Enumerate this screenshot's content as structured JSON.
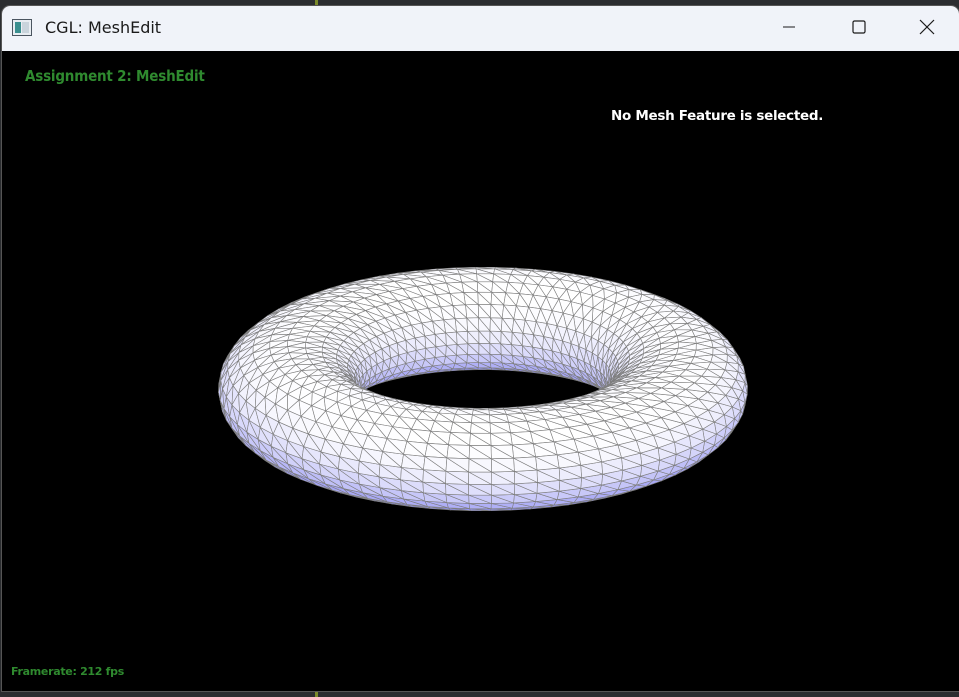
{
  "window": {
    "title": "CGL: MeshEdit",
    "app_icon": "app-window-icon"
  },
  "controls": {
    "minimize_icon": "minimize-icon",
    "maximize_icon": "maximize-icon",
    "close_icon": "close-icon"
  },
  "viewport": {
    "assignment_title": "Assignment 2: MeshEdit",
    "selection_status": "No Mesh Feature is selected.",
    "framerate": "Framerate: 212 fps"
  },
  "colors": {
    "overlay_text": "#2f8a2f",
    "status_text": "#ffffff",
    "mesh_fill_light": "#ffffff",
    "mesh_fill_shadow": "#8f8ff2",
    "mesh_wire": "#7d7d7d",
    "background": "#000000"
  }
}
